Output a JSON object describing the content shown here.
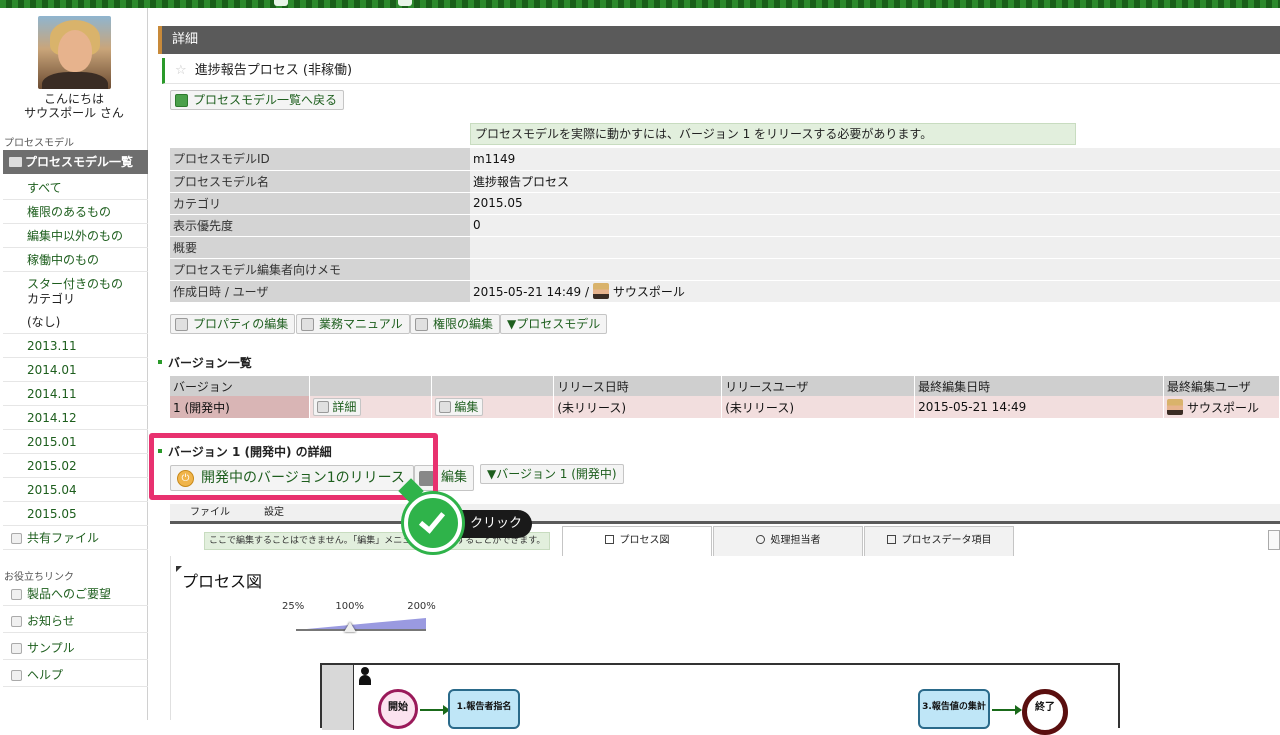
{
  "sidebar": {
    "greeting_line1": "こんにちは",
    "greeting_line2": "サウスポール さん",
    "section_process_model": "プロセスモデル",
    "active_item": "プロセスモデル一覧",
    "items": [
      "すべて",
      "権限のあるもの",
      "編集中以外のもの",
      "稼働中のもの",
      "スター付きのもの"
    ],
    "category_label": "カテゴリ",
    "categories": [
      "(なし)",
      "2013.11",
      "2014.01",
      "2014.11",
      "2014.12",
      "2015.01",
      "2015.02",
      "2015.04",
      "2015.05"
    ],
    "shared_files": "共有ファイル",
    "section_links": "お役立ちリンク",
    "links": [
      "製品へのご要望",
      "お知らせ",
      "サンプル",
      "ヘルプ"
    ]
  },
  "header": {
    "title": "詳細",
    "process_title": "進捗報告プロセス (非稼働)",
    "back_button": "プロセスモデル一覧へ戻る"
  },
  "notice": "プロセスモデルを実際に動かすには、バージョン 1 をリリースする必要があります。",
  "properties": [
    {
      "key": "プロセスモデルID",
      "value": "m1149"
    },
    {
      "key": "プロセスモデル名",
      "value": "進捗報告プロセス"
    },
    {
      "key": "カテゴリ",
      "value": "2015.05"
    },
    {
      "key": "表示優先度",
      "value": "0"
    },
    {
      "key": "概要",
      "value": ""
    },
    {
      "key": "プロセスモデル編集者向けメモ",
      "value": ""
    },
    {
      "key": "作成日時 / ユーザ",
      "value": "2015-05-21 14:49 / ",
      "user": "サウスポール"
    }
  ],
  "prop_buttons": [
    "プロパティの編集",
    "業務マニュアル",
    "権限の編集",
    "▼プロセスモデル"
  ],
  "versions": {
    "heading": "バージョン一覧",
    "columns": [
      "バージョン",
      "",
      "",
      "リリース日時",
      "リリースユーザ",
      "最終編集日時",
      "最終編集ユーザ"
    ],
    "row": {
      "version": "1 (開発中)",
      "detail_btn": "詳細",
      "edit_btn": "編集",
      "release_date": "(未リリース)",
      "release_user": "(未リリース)",
      "last_edit": "2015-05-21 14:49",
      "last_user": "サウスポール"
    }
  },
  "version_detail": {
    "heading": "バージョン 1 (開発中) の詳細",
    "release_button": "開発中のバージョン1のリリース",
    "edit_button": "編集",
    "version_dropdown": "▼バージョン 1 (開発中)"
  },
  "editor": {
    "menu": [
      "ファイル",
      "設定"
    ],
    "notice": "ここで編集することはできません。「編集」メニューから編集することができます。",
    "tabs": [
      "プロセス図",
      "処理担当者",
      "プロセスデータ項目"
    ],
    "diagram_title": "プロセス図",
    "zoom_labels": [
      "25%",
      "100%",
      "200%"
    ],
    "zoom_level_percent": 100,
    "nodes": {
      "start": "開始",
      "task1": "1.報告者指名",
      "task3": "3.報告値の集計",
      "end": "終了"
    }
  },
  "annotation": {
    "label": "クリック"
  }
}
